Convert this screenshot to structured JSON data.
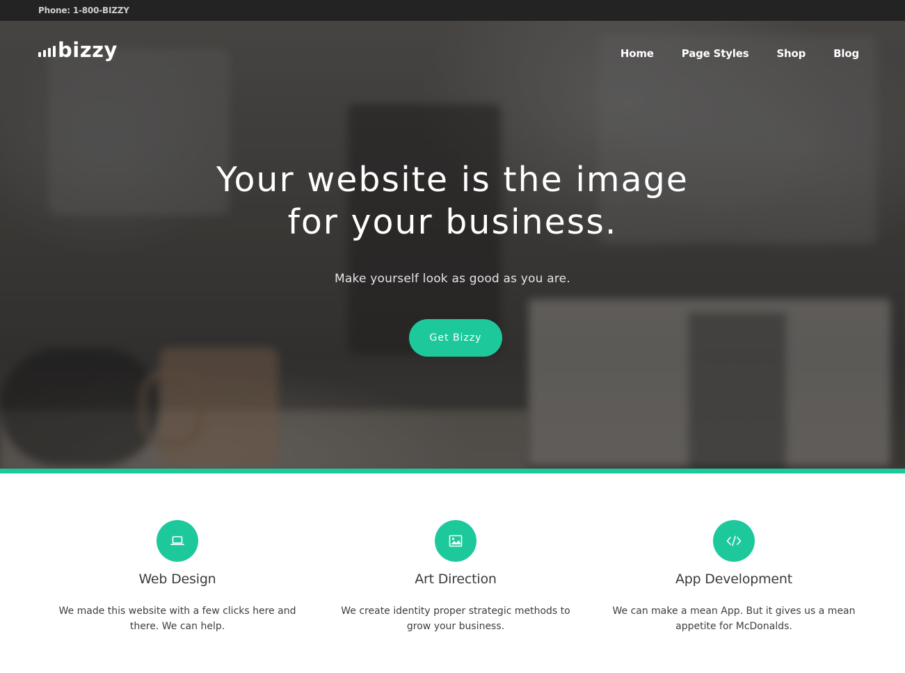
{
  "topbar": {
    "phone": "Phone: 1-800-BIZZY"
  },
  "logo": {
    "text": "bizzy"
  },
  "nav": {
    "items": [
      {
        "label": "Home"
      },
      {
        "label": "Page Styles"
      },
      {
        "label": "Shop"
      },
      {
        "label": "Blog"
      }
    ]
  },
  "hero": {
    "headline_line1": "Your website is the image",
    "headline_line2": "for your business.",
    "subheadline": "Make yourself look as good as you are.",
    "cta_label": "Get Bizzy"
  },
  "colors": {
    "accent": "#1dc99b",
    "topbar": "#232323"
  },
  "features": [
    {
      "icon": "laptop-icon",
      "title": "Web Design",
      "description": "We made this website with a few clicks here and there. We can help."
    },
    {
      "icon": "image-icon",
      "title": "Art Direction",
      "description": "We create identity proper strategic methods to grow your business."
    },
    {
      "icon": "code-icon",
      "title": "App Development",
      "description": "We can make a mean App. But it gives us a mean appetite for McDonalds."
    }
  ]
}
